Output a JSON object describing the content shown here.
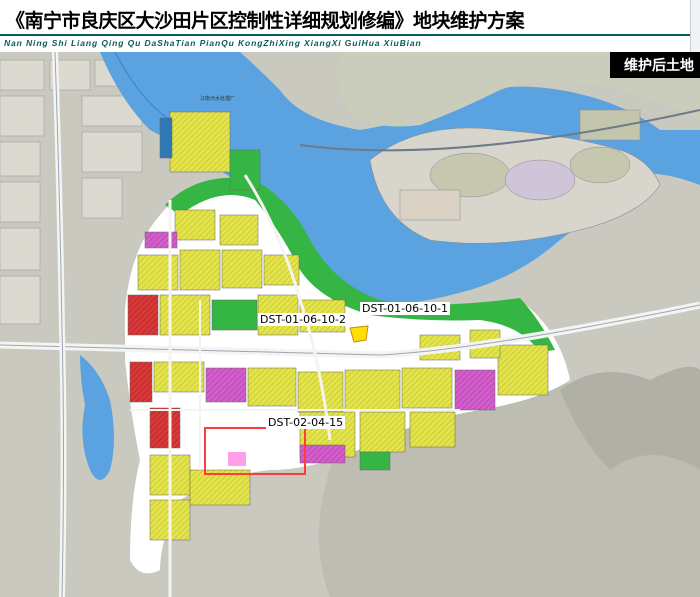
{
  "header": {
    "title": "《南宁市良庆区大沙田片区控制性详细规划修编》地块维护方案",
    "subtitle": "Nan Ning Shi Liang Qing Qu DaShaTian PianQu KongZhiXing XiangXi GuiHua XiuBian"
  },
  "map": {
    "panel_label": "维护后土地",
    "parcels": [
      {
        "code": "DST-01-06-10-1"
      },
      {
        "code": "DST-01-06-10-2"
      },
      {
        "code": "DST-02-04-15"
      }
    ],
    "place_label": "江南污水处理厂",
    "colors": {
      "residential": "#e8e84a",
      "commercial": "#e03a3a",
      "public_service": "#d860d0",
      "green": "#2eaa38",
      "water": "#5aa0dd",
      "highlight_box": "#ff3b3b"
    }
  }
}
